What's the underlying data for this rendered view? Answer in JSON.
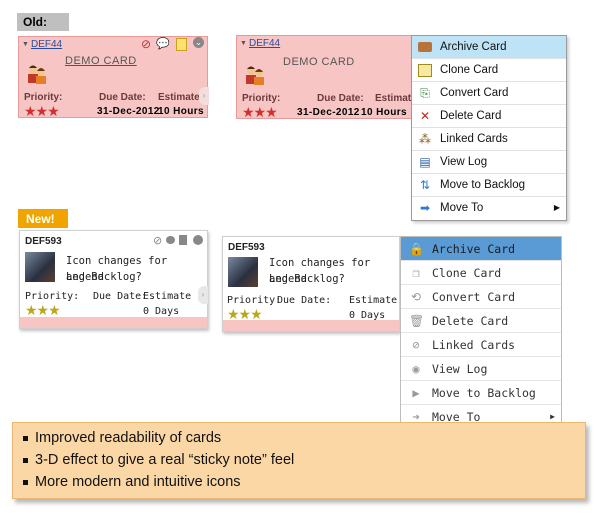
{
  "labels": {
    "old": "Old:",
    "new": "New!"
  },
  "old_card_left": {
    "id": "DEF44",
    "title": "DEMO CARD",
    "priority_label": "Priority:",
    "due_label": "Due Date:",
    "estimate_label": "Estimate:",
    "due_value": "31-Dec-2012",
    "estimate_value": "10 Hours",
    "stars": "★★★"
  },
  "old_card_right": {
    "id": "DEF44",
    "title": "DEMO CARD",
    "priority_label": "Priority:",
    "due_label": "Due Date:",
    "estimate_label": "Estimate:",
    "due_value": "31-Dec-2012",
    "estimate_value": "10 Hours",
    "stars": "★★★"
  },
  "old_menu": {
    "items": [
      {
        "label": "Archive Card",
        "icon": "briefcase-icon"
      },
      {
        "label": "Clone Card",
        "icon": "clone-icon"
      },
      {
        "label": "Convert Card",
        "icon": "convert-icon"
      },
      {
        "label": "Delete Card",
        "icon": "delete-x-icon"
      },
      {
        "label": "Linked Cards",
        "icon": "linked-icon"
      },
      {
        "label": "View Log",
        "icon": "log-icon"
      },
      {
        "label": "Move to Backlog",
        "icon": "backlog-icon"
      },
      {
        "label": "Move To",
        "icon": "move-icon"
      }
    ]
  },
  "new_card_left": {
    "id": "DEF593",
    "title_line1": "Icon changes for Legend",
    "title_line2": "and Backlog?",
    "priority_label": "Priority:",
    "due_label": "Due Date:",
    "estimate_label": "Estimate",
    "estimate_value": "0 Days",
    "stars": "★★★"
  },
  "new_card_right": {
    "id": "DEF593",
    "title_line1": "Icon changes for Legend",
    "title_line2": "and Backlog?",
    "priority_label": "Priority:",
    "due_label": "Due Date:",
    "estimate_label": "Estimate",
    "estimate_value": "0 Days",
    "stars": "★★★"
  },
  "new_menu": {
    "items": [
      {
        "label": "Archive Card",
        "icon": "lock-icon"
      },
      {
        "label": "Clone Card",
        "icon": "clone-icon"
      },
      {
        "label": "Convert Card",
        "icon": "convert-icon"
      },
      {
        "label": "Delete Card",
        "icon": "trash-icon"
      },
      {
        "label": "Linked Cards",
        "icon": "link-icon"
      },
      {
        "label": "View Log",
        "icon": "eye-icon"
      },
      {
        "label": "Move to Backlog",
        "icon": "play-icon"
      },
      {
        "label": "Move To",
        "icon": "arrow-right-icon"
      }
    ]
  },
  "summary": {
    "bullets": [
      "Improved readability of cards",
      "3-D effect to give a real “sticky note” feel",
      "More modern and intuitive icons"
    ]
  },
  "colors": {
    "old_card_bg": "#f8c5c5",
    "menu_old_highlight": "#bfe3f6",
    "menu_new_highlight": "#5b9bd5",
    "summary_bg": "#fbd7a6",
    "new_tag": "#f0a400",
    "old_tag": "#bfbfbf"
  }
}
